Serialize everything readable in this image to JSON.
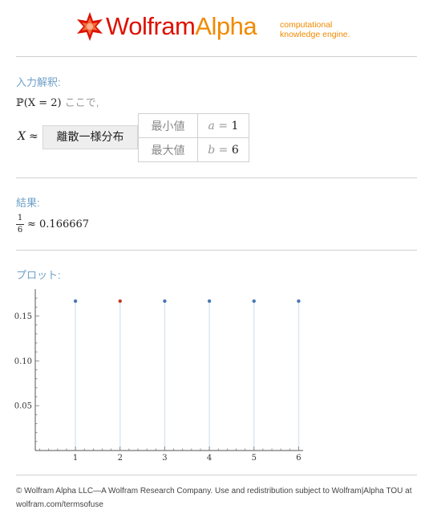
{
  "header": {
    "brand_wolfram": "Wolfram",
    "brand_alpha": "Alpha",
    "tagline_line1": "computational",
    "tagline_line2": "knowledge engine.",
    "brand_color_red": "#dd1100",
    "brand_color_orange": "#f08a00"
  },
  "input_interpretation": {
    "title": "入力解釈:",
    "prob_expr": "ℙ(X = 2)",
    "where_text": "ここで,",
    "variable": "X",
    "approx_symbol": "≈",
    "distribution_button": "離散一様分布",
    "params": [
      {
        "label": "最小値",
        "symbol": "a",
        "eq": "=",
        "value": "1"
      },
      {
        "label": "最大値",
        "symbol": "b",
        "eq": "=",
        "value": "6"
      }
    ]
  },
  "result": {
    "title": "結果:",
    "numerator": "1",
    "denominator": "6",
    "approx_text": "≈ 0.166667"
  },
  "plot": {
    "title": "プロット:"
  },
  "chart_data": {
    "type": "scatter",
    "style": "stem",
    "x": [
      1,
      2,
      3,
      4,
      5,
      6
    ],
    "y": [
      0.166667,
      0.166667,
      0.166667,
      0.166667,
      0.166667,
      0.166667
    ],
    "highlight_x": 2,
    "point_color": "#4a78b5",
    "highlight_color": "#c0392b",
    "stem_color": "#dde6f3",
    "xlim": [
      0.1,
      6.1
    ],
    "ylim": [
      0,
      0.18
    ],
    "xticks": [
      "1",
      "2",
      "3",
      "4",
      "5",
      "6"
    ],
    "yticks": [
      "0.05",
      "0.10",
      "0.15"
    ],
    "ytick_values": [
      0.05,
      0.1,
      0.15
    ]
  },
  "footer": {
    "line1": "© Wolfram Alpha LLC—A Wolfram Research Company. Use and redistribution subject to Wolfram|Alpha TOU at",
    "line2": "wolfram.com/termsofuse"
  }
}
